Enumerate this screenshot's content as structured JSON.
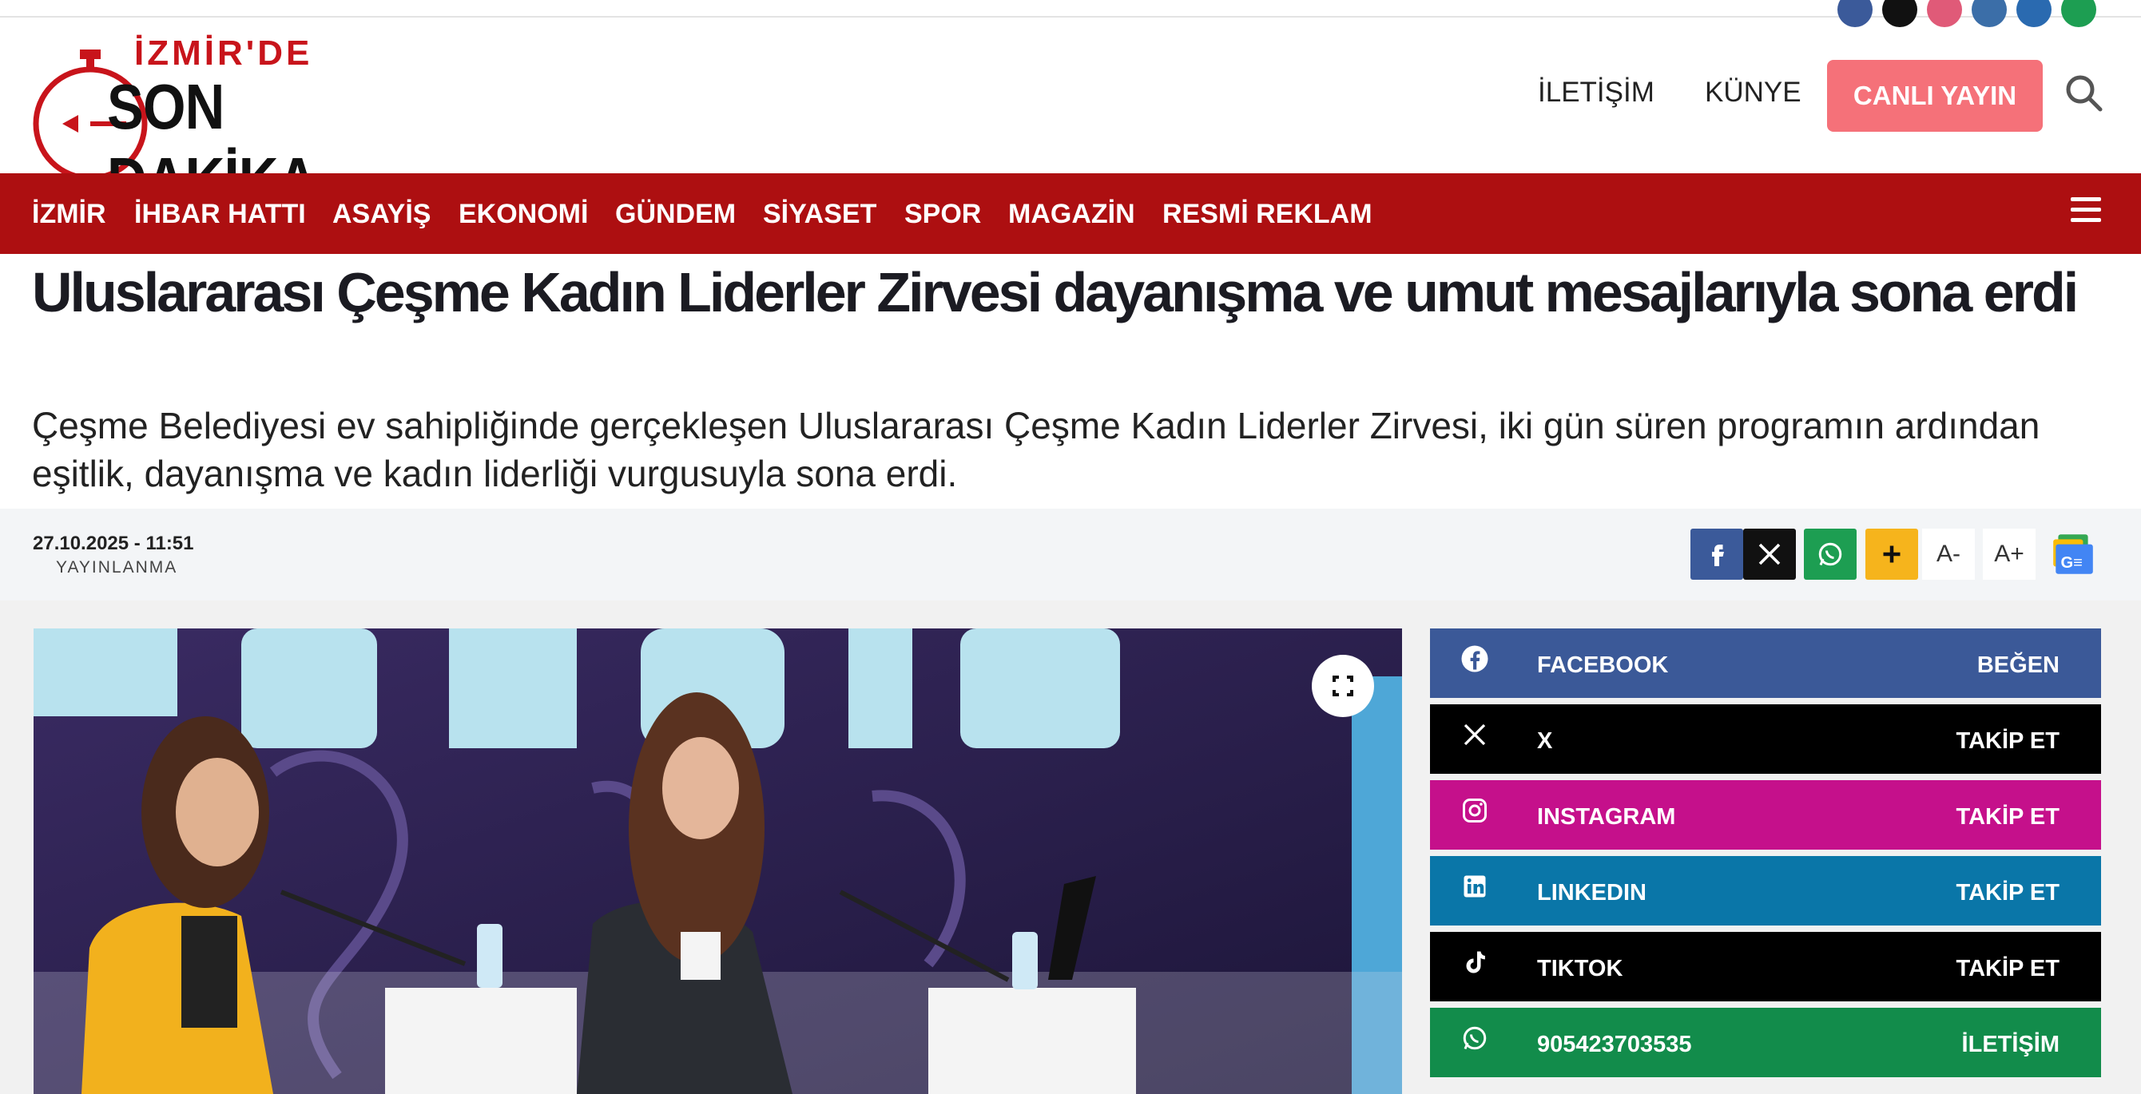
{
  "logo": {
    "line1": "İZMİR'DE",
    "line2": "SON DAKİKA"
  },
  "header": {
    "nav": [
      "İLETİŞİM",
      "KÜNYE"
    ],
    "live_button": "CANLI YAYIN",
    "search_icon": "search-icon"
  },
  "categories": [
    "İZMİR",
    "İHBAR HATTI",
    "ASAYİŞ",
    "EKONOMİ",
    "GÜNDEM",
    "SİYASET",
    "SPOR",
    "MAGAZİN",
    "RESMİ REKLAM"
  ],
  "article": {
    "title": "Uluslararası Çeşme Kadın Liderler Zirvesi dayanışma ve umut mesajlarıyla sona erdi",
    "summary": "Çeşme Belediyesi ev sahipliğinde gerçekleşen Uluslararası Çeşme Kadın Liderler Zirvesi, iki gün süren programın ardından eşitlik, dayanışma ve kadın liderliği vurgusuyla sona erdi.",
    "date": "27.10.2025 - 11:51",
    "date_label": "YAYINLANMA"
  },
  "share": {
    "font_smaller": "A-",
    "font_larger": "A+",
    "colors": {
      "facebook": "#3b5a9a",
      "x": "#111111",
      "whatsapp": "#1d9e52",
      "more": "#f6b41c"
    }
  },
  "social": [
    {
      "name": "FACEBOOK",
      "action": "BEĞEN",
      "icon": "facebook-icon",
      "color": "#3b5998"
    },
    {
      "name": "X",
      "action": "TAKİP ET",
      "icon": "x-icon",
      "color": "#000000"
    },
    {
      "name": "INSTAGRAM",
      "action": "TAKİP ET",
      "icon": "instagram-icon",
      "color": "#c5108b"
    },
    {
      "name": "LINKEDIN",
      "action": "TAKİP ET",
      "icon": "linkedin-icon",
      "color": "#0a76a8"
    },
    {
      "name": "TIKTOK",
      "action": "TAKİP ET",
      "icon": "tiktok-icon",
      "color": "#000000"
    },
    {
      "name": "905423703535",
      "action": "İLETİŞİM",
      "icon": "whatsapp-icon",
      "color": "#128c4b"
    }
  ],
  "colors": {
    "brand_red": "#ad0f11",
    "live_button": "#f57179"
  }
}
